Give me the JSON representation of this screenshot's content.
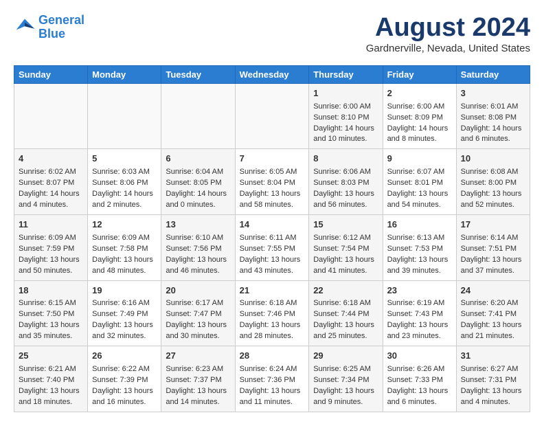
{
  "logo": {
    "line1": "General",
    "line2": "Blue"
  },
  "title": "August 2024",
  "location": "Gardnerville, Nevada, United States",
  "weekdays": [
    "Sunday",
    "Monday",
    "Tuesday",
    "Wednesday",
    "Thursday",
    "Friday",
    "Saturday"
  ],
  "weeks": [
    [
      {
        "day": "",
        "sunrise": "",
        "sunset": "",
        "daylight": ""
      },
      {
        "day": "",
        "sunrise": "",
        "sunset": "",
        "daylight": ""
      },
      {
        "day": "",
        "sunrise": "",
        "sunset": "",
        "daylight": ""
      },
      {
        "day": "",
        "sunrise": "",
        "sunset": "",
        "daylight": ""
      },
      {
        "day": "1",
        "sunrise": "Sunrise: 6:00 AM",
        "sunset": "Sunset: 8:10 PM",
        "daylight": "Daylight: 14 hours and 10 minutes."
      },
      {
        "day": "2",
        "sunrise": "Sunrise: 6:00 AM",
        "sunset": "Sunset: 8:09 PM",
        "daylight": "Daylight: 14 hours and 8 minutes."
      },
      {
        "day": "3",
        "sunrise": "Sunrise: 6:01 AM",
        "sunset": "Sunset: 8:08 PM",
        "daylight": "Daylight: 14 hours and 6 minutes."
      }
    ],
    [
      {
        "day": "4",
        "sunrise": "Sunrise: 6:02 AM",
        "sunset": "Sunset: 8:07 PM",
        "daylight": "Daylight: 14 hours and 4 minutes."
      },
      {
        "day": "5",
        "sunrise": "Sunrise: 6:03 AM",
        "sunset": "Sunset: 8:06 PM",
        "daylight": "Daylight: 14 hours and 2 minutes."
      },
      {
        "day": "6",
        "sunrise": "Sunrise: 6:04 AM",
        "sunset": "Sunset: 8:05 PM",
        "daylight": "Daylight: 14 hours and 0 minutes."
      },
      {
        "day": "7",
        "sunrise": "Sunrise: 6:05 AM",
        "sunset": "Sunset: 8:04 PM",
        "daylight": "Daylight: 13 hours and 58 minutes."
      },
      {
        "day": "8",
        "sunrise": "Sunrise: 6:06 AM",
        "sunset": "Sunset: 8:03 PM",
        "daylight": "Daylight: 13 hours and 56 minutes."
      },
      {
        "day": "9",
        "sunrise": "Sunrise: 6:07 AM",
        "sunset": "Sunset: 8:01 PM",
        "daylight": "Daylight: 13 hours and 54 minutes."
      },
      {
        "day": "10",
        "sunrise": "Sunrise: 6:08 AM",
        "sunset": "Sunset: 8:00 PM",
        "daylight": "Daylight: 13 hours and 52 minutes."
      }
    ],
    [
      {
        "day": "11",
        "sunrise": "Sunrise: 6:09 AM",
        "sunset": "Sunset: 7:59 PM",
        "daylight": "Daylight: 13 hours and 50 minutes."
      },
      {
        "day": "12",
        "sunrise": "Sunrise: 6:09 AM",
        "sunset": "Sunset: 7:58 PM",
        "daylight": "Daylight: 13 hours and 48 minutes."
      },
      {
        "day": "13",
        "sunrise": "Sunrise: 6:10 AM",
        "sunset": "Sunset: 7:56 PM",
        "daylight": "Daylight: 13 hours and 46 minutes."
      },
      {
        "day": "14",
        "sunrise": "Sunrise: 6:11 AM",
        "sunset": "Sunset: 7:55 PM",
        "daylight": "Daylight: 13 hours and 43 minutes."
      },
      {
        "day": "15",
        "sunrise": "Sunrise: 6:12 AM",
        "sunset": "Sunset: 7:54 PM",
        "daylight": "Daylight: 13 hours and 41 minutes."
      },
      {
        "day": "16",
        "sunrise": "Sunrise: 6:13 AM",
        "sunset": "Sunset: 7:53 PM",
        "daylight": "Daylight: 13 hours and 39 minutes."
      },
      {
        "day": "17",
        "sunrise": "Sunrise: 6:14 AM",
        "sunset": "Sunset: 7:51 PM",
        "daylight": "Daylight: 13 hours and 37 minutes."
      }
    ],
    [
      {
        "day": "18",
        "sunrise": "Sunrise: 6:15 AM",
        "sunset": "Sunset: 7:50 PM",
        "daylight": "Daylight: 13 hours and 35 minutes."
      },
      {
        "day": "19",
        "sunrise": "Sunrise: 6:16 AM",
        "sunset": "Sunset: 7:49 PM",
        "daylight": "Daylight: 13 hours and 32 minutes."
      },
      {
        "day": "20",
        "sunrise": "Sunrise: 6:17 AM",
        "sunset": "Sunset: 7:47 PM",
        "daylight": "Daylight: 13 hours and 30 minutes."
      },
      {
        "day": "21",
        "sunrise": "Sunrise: 6:18 AM",
        "sunset": "Sunset: 7:46 PM",
        "daylight": "Daylight: 13 hours and 28 minutes."
      },
      {
        "day": "22",
        "sunrise": "Sunrise: 6:18 AM",
        "sunset": "Sunset: 7:44 PM",
        "daylight": "Daylight: 13 hours and 25 minutes."
      },
      {
        "day": "23",
        "sunrise": "Sunrise: 6:19 AM",
        "sunset": "Sunset: 7:43 PM",
        "daylight": "Daylight: 13 hours and 23 minutes."
      },
      {
        "day": "24",
        "sunrise": "Sunrise: 6:20 AM",
        "sunset": "Sunset: 7:41 PM",
        "daylight": "Daylight: 13 hours and 21 minutes."
      }
    ],
    [
      {
        "day": "25",
        "sunrise": "Sunrise: 6:21 AM",
        "sunset": "Sunset: 7:40 PM",
        "daylight": "Daylight: 13 hours and 18 minutes."
      },
      {
        "day": "26",
        "sunrise": "Sunrise: 6:22 AM",
        "sunset": "Sunset: 7:39 PM",
        "daylight": "Daylight: 13 hours and 16 minutes."
      },
      {
        "day": "27",
        "sunrise": "Sunrise: 6:23 AM",
        "sunset": "Sunset: 7:37 PM",
        "daylight": "Daylight: 13 hours and 14 minutes."
      },
      {
        "day": "28",
        "sunrise": "Sunrise: 6:24 AM",
        "sunset": "Sunset: 7:36 PM",
        "daylight": "Daylight: 13 hours and 11 minutes."
      },
      {
        "day": "29",
        "sunrise": "Sunrise: 6:25 AM",
        "sunset": "Sunset: 7:34 PM",
        "daylight": "Daylight: 13 hours and 9 minutes."
      },
      {
        "day": "30",
        "sunrise": "Sunrise: 6:26 AM",
        "sunset": "Sunset: 7:33 PM",
        "daylight": "Daylight: 13 hours and 6 minutes."
      },
      {
        "day": "31",
        "sunrise": "Sunrise: 6:27 AM",
        "sunset": "Sunset: 7:31 PM",
        "daylight": "Daylight: 13 hours and 4 minutes."
      }
    ]
  ]
}
